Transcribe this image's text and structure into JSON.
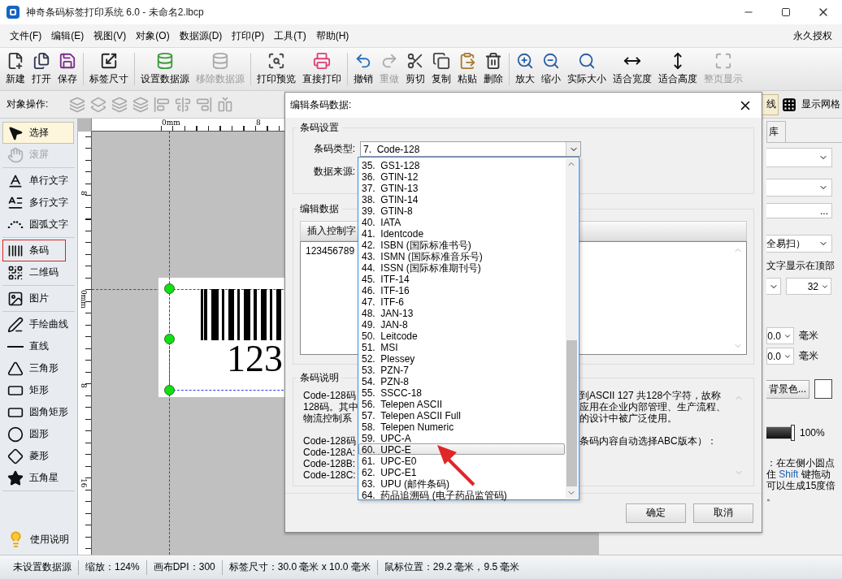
{
  "window": {
    "title": "神奇条码标签打印系统 6.0 - 未命名2.lbcp"
  },
  "menu": {
    "items": [
      "文件(F)",
      "编辑(E)",
      "视图(V)",
      "对象(O)",
      "数据源(D)",
      "打印(P)",
      "工具(T)",
      "帮助(H)"
    ],
    "license": "永久授权"
  },
  "toolbar": {
    "groups": [
      [
        {
          "label": "新建",
          "disabled": false
        },
        {
          "label": "打开",
          "disabled": false
        },
        {
          "label": "保存",
          "disabled": false
        }
      ],
      [
        {
          "label": "标签尺寸",
          "disabled": false
        }
      ],
      [
        {
          "label": "设置数据源",
          "disabled": false
        },
        {
          "label": "移除数据源",
          "disabled": true
        }
      ],
      [
        {
          "label": "打印预览",
          "disabled": false
        },
        {
          "label": "直接打印",
          "disabled": false
        }
      ],
      [
        {
          "label": "撤销",
          "disabled": false
        },
        {
          "label": "重做",
          "disabled": true
        },
        {
          "label": "剪切",
          "disabled": false
        },
        {
          "label": "复制",
          "disabled": false
        },
        {
          "label": "粘贴",
          "disabled": false
        },
        {
          "label": "删除",
          "disabled": false
        }
      ],
      [
        {
          "label": "放大",
          "disabled": false
        },
        {
          "label": "缩小",
          "disabled": false
        },
        {
          "label": "实际大小",
          "disabled": false
        },
        {
          "label": "适合宽度",
          "disabled": false
        },
        {
          "label": "适合高度",
          "disabled": false
        },
        {
          "label": "整页显示",
          "disabled": true
        }
      ]
    ]
  },
  "object_toolbar": {
    "label": "对象操作:",
    "partial_button": "线",
    "grid_button": "显示网格"
  },
  "tools": {
    "groups": [
      [
        {
          "label": "选择",
          "selected": true,
          "disabled": false,
          "highlighted": false
        },
        {
          "label": "滚屏",
          "selected": false,
          "disabled": true,
          "highlighted": false
        }
      ],
      [
        {
          "label": "单行文字",
          "selected": false,
          "disabled": false,
          "highlighted": false
        },
        {
          "label": "多行文字",
          "selected": false,
          "disabled": false,
          "highlighted": false
        },
        {
          "label": "圆弧文字",
          "selected": false,
          "disabled": false,
          "highlighted": false
        }
      ],
      [
        {
          "label": "条码",
          "selected": false,
          "disabled": false,
          "highlighted": true
        },
        {
          "label": "二维码",
          "selected": false,
          "disabled": false,
          "highlighted": false
        }
      ],
      [
        {
          "label": "图片",
          "selected": false,
          "disabled": false,
          "highlighted": false
        }
      ],
      [
        {
          "label": "手绘曲线",
          "selected": false,
          "disabled": false,
          "highlighted": false
        },
        {
          "label": "直线",
          "selected": false,
          "disabled": false,
          "highlighted": false
        },
        {
          "label": "三角形",
          "selected": false,
          "disabled": false,
          "highlighted": false
        },
        {
          "label": "矩形",
          "selected": false,
          "disabled": false,
          "highlighted": false
        },
        {
          "label": "圆角矩形",
          "selected": false,
          "disabled": false,
          "highlighted": false
        },
        {
          "label": "圆形",
          "selected": false,
          "disabled": false,
          "highlighted": false
        },
        {
          "label": "菱形",
          "selected": false,
          "disabled": false,
          "highlighted": false
        },
        {
          "label": "五角星",
          "selected": false,
          "disabled": false,
          "highlighted": false
        }
      ]
    ],
    "help": "使用说明"
  },
  "canvas": {
    "top_ruler": [
      "0mm",
      "8"
    ],
    "left_ruler": [
      "8",
      "0mm",
      "8",
      "16"
    ],
    "label_text": "123"
  },
  "right_panel": {
    "tab": "库",
    "field_3": "...",
    "combo_text": "全易扫）",
    "option": "文字显示在顶部",
    "size": "32",
    "offsets": [
      {
        "value": "0.0",
        "unit": "毫米"
      },
      {
        "value": "0.0",
        "unit": "毫米"
      }
    ],
    "background_button": "背景色...",
    "opacity": {
      "level": 1,
      "reading": "100%"
    },
    "hint_lines": [
      [
        {
          "text": "：在左侧小圆点",
          "highlight": false
        }
      ],
      [
        {
          "text": "住 ",
          "highlight": false
        },
        {
          "text": "Shift",
          "highlight": true
        },
        {
          "text": " 键拖动",
          "highlight": false
        }
      ],
      [
        {
          "text": "可以生成15度倍",
          "highlight": false
        }
      ],
      [
        {
          "text": "。",
          "highlight": false
        }
      ]
    ]
  },
  "dialog": {
    "title": "编辑条码数据:",
    "settings_group": "条码设置",
    "type_label": "条码类型:",
    "type_value": "7.  Code-128",
    "source_label": "数据来源:",
    "data_group": "编辑数据",
    "insert_button": "插入控制字",
    "data_value": "123456789",
    "desc_group": "条码说明",
    "desc_paragraphs": [
      [
        {
          "left": "Code-128码",
          "right": "到ASCII 127 共128个字符，故称"
        },
        {
          "left": "128码。其中",
          "right": "应用在企业内部管理、生产流程、"
        },
        {
          "left": "物流控制系",
          "right": "的设计中被广泛使用。"
        }
      ],
      [
        {
          "left": "Code-128码",
          "right": "条码内容自动选择ABC版本）："
        },
        {
          "left": "Code-128A:"
        },
        {
          "left": "Code-128B:"
        },
        {
          "left": "Code-128C:"
        }
      ]
    ],
    "buttons": [
      "确定",
      "取消"
    ],
    "dropdown": {
      "items": [
        {
          "label": "35.  GS1-128",
          "selected": false
        },
        {
          "label": "36.  GTIN-12",
          "selected": false
        },
        {
          "label": "37.  GTIN-13",
          "selected": false
        },
        {
          "label": "38.  GTIN-14",
          "selected": false
        },
        {
          "label": "39.  GTIN-8",
          "selected": false
        },
        {
          "label": "40.  IATA",
          "selected": false
        },
        {
          "label": "41.  Identcode",
          "selected": false
        },
        {
          "label": "42.  ISBN (国际标准书号)",
          "selected": false
        },
        {
          "label": "43.  ISMN (国际标准音乐号)",
          "selected": false
        },
        {
          "label": "44.  ISSN (国际标准期刊号)",
          "selected": false
        },
        {
          "label": "45.  ITF-14",
          "selected": false
        },
        {
          "label": "46.  ITF-16",
          "selected": false
        },
        {
          "label": "47.  ITF-6",
          "selected": false
        },
        {
          "label": "48.  JAN-13",
          "selected": false
        },
        {
          "label": "49.  JAN-8",
          "selected": false
        },
        {
          "label": "50.  Leitcode",
          "selected": false
        },
        {
          "label": "51.  MSI",
          "selected": false
        },
        {
          "label": "52.  Plessey",
          "selected": false
        },
        {
          "label": "53.  PZN-7",
          "selected": false
        },
        {
          "label": "54.  PZN-8",
          "selected": false
        },
        {
          "label": "55.  SSCC-18",
          "selected": false
        },
        {
          "label": "56.  Telepen ASCII",
          "selected": false
        },
        {
          "label": "57.  Telepen ASCII Full",
          "selected": false
        },
        {
          "label": "58.  Telepen Numeric",
          "selected": false
        },
        {
          "label": "59.  UPC-A",
          "selected": false
        },
        {
          "label": "60.  UPC-E",
          "selected": true
        },
        {
          "label": "61.  UPC-E0",
          "selected": false
        },
        {
          "label": "62.  UPC-E1",
          "selected": false
        },
        {
          "label": "63.  UPU (邮件条码)",
          "selected": false
        },
        {
          "label": "64.  药品追溯码 (电子药品监管码)",
          "selected": false
        }
      ]
    }
  },
  "status_bar": [
    "未设置数据源",
    "缩放：124%",
    "画布DPI：300",
    "标签尺寸：30.0 毫米 x 10.0 毫米",
    "鼠标位置：29.2 毫米，9.5 毫米"
  ]
}
